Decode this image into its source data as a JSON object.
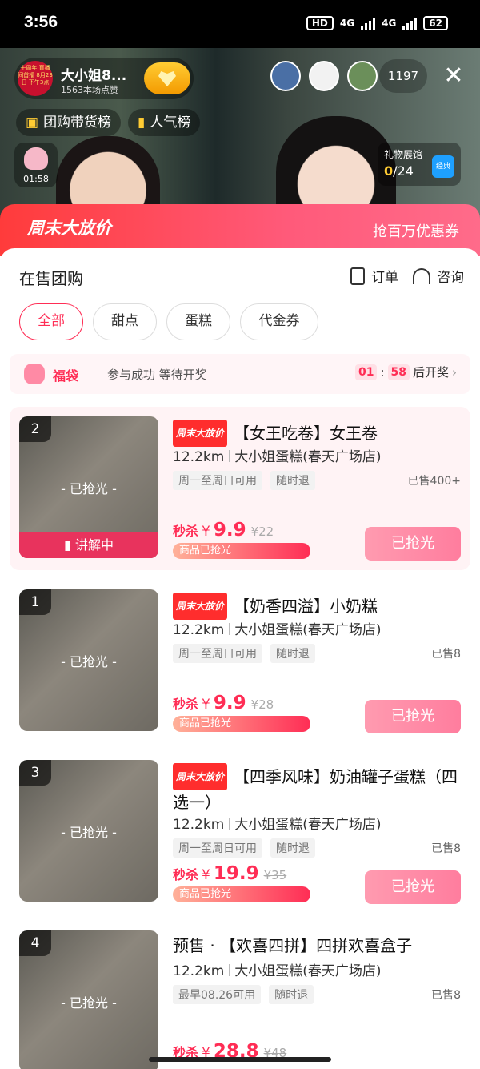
{
  "status": {
    "time": "3:56",
    "hd": "HD",
    "net1": "4G",
    "net2": "4G",
    "battery": "62"
  },
  "host": {
    "name": "大小姐8...",
    "likes": "1563本场点赞",
    "avatar_text": "十周年 直播间首播 8月23日 下午3点"
  },
  "viewer_count": "1197",
  "chips": {
    "group_rank": "团购带货榜",
    "popular_rank": "人气榜"
  },
  "lucky_bag_timer": "01:58",
  "gift_hall": {
    "label": "礼物展馆",
    "count": "0",
    "total": "/24",
    "badge": "经典"
  },
  "banner": {
    "promo": "周末大放价",
    "coupon": "抢百万优惠券"
  },
  "panel": {
    "title": "在售团购",
    "orders": "订单",
    "consult": "咨询"
  },
  "tabs": [
    "全部",
    "甜点",
    "蛋糕",
    "代金券"
  ],
  "lucky": {
    "label": "福袋",
    "status": "参与成功 等待开奖",
    "min": "01",
    "sep": ":",
    "sec": "58",
    "suffix": "后开奖"
  },
  "products": [
    {
      "rank": "2",
      "tag": "周末大放价",
      "name": "【女王吃卷】女王卷",
      "dist": "12.2km",
      "shop": "大小姐蛋糕(春天广场店)",
      "tags": [
        "周一至周日可用",
        "随时退"
      ],
      "sold": "已售400+",
      "price_label": "秒杀",
      "cur": "¥",
      "price": "9.9",
      "old": "¥22",
      "bar": "商品已抢光",
      "btn": "已抢光",
      "overlay": "- 已抢光 -",
      "live": "讲解中"
    },
    {
      "rank": "1",
      "tag": "周末大放价",
      "name": "【奶香四溢】小奶糕",
      "dist": "12.2km",
      "shop": "大小姐蛋糕(春天广场店)",
      "tags": [
        "周一至周日可用",
        "随时退"
      ],
      "sold": "已售8",
      "price_label": "秒杀",
      "cur": "¥",
      "price": "9.9",
      "old": "¥28",
      "bar": "商品已抢光",
      "btn": "已抢光",
      "overlay": "- 已抢光 -"
    },
    {
      "rank": "3",
      "tag": "周末大放价",
      "name": "【四季风味】奶油罐子蛋糕（四选一）",
      "dist": "12.2km",
      "shop": "大小姐蛋糕(春天广场店)",
      "tags": [
        "周一至周日可用",
        "随时退"
      ],
      "sold": "已售8",
      "price_label": "秒杀",
      "cur": "¥",
      "price": "19.9",
      "old": "¥35",
      "bar": "商品已抢光",
      "btn": "已抢光",
      "overlay": "- 已抢光 -"
    },
    {
      "rank": "4",
      "prefix": "预售 · ",
      "name": "【欢喜四拼】四拼欢喜盒子",
      "dist": "12.2km",
      "shop": "大小姐蛋糕(春天广场店)",
      "tags": [
        "最早08.26可用",
        "随时退"
      ],
      "sold": "已售8",
      "price_label": "秒杀",
      "cur": "¥",
      "price": "28.8",
      "old": "¥48",
      "overlay": "- 已抢光 -"
    }
  ]
}
